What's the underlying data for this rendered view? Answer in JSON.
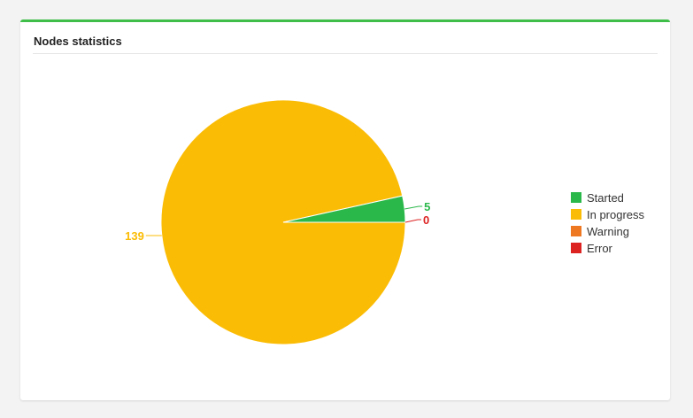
{
  "panel": {
    "title": "Nodes statistics",
    "accent_color": "#3fbf4a"
  },
  "chart_data": {
    "type": "pie",
    "title": "Nodes statistics",
    "slices": [
      {
        "label": "Started",
        "value": 5,
        "color": "#2ab84a"
      },
      {
        "label": "In progress",
        "value": 139,
        "color": "#fbbc05"
      },
      {
        "label": "Warning",
        "value": 0,
        "color": "#ee7722"
      },
      {
        "label": "Error",
        "value": 0,
        "color": "#dd2222"
      }
    ],
    "legend": "right"
  }
}
